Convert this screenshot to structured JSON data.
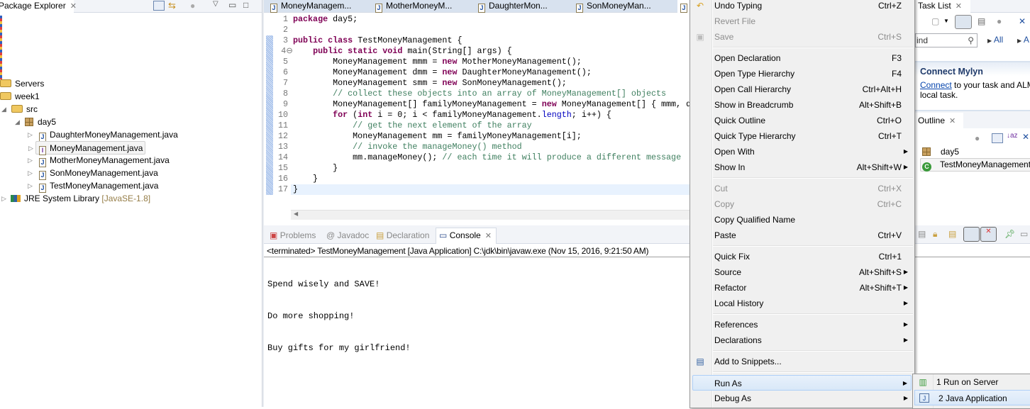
{
  "package_explorer": {
    "title": "Package Explorer",
    "items": [
      {
        "label": "Servers",
        "type": "project"
      },
      {
        "label": "week1",
        "type": "project",
        "expanded": true
      },
      {
        "label": "src",
        "type": "source-folder",
        "expanded": true
      },
      {
        "label": "day5",
        "type": "package",
        "expanded": true
      },
      {
        "label": "DaughterMoneyManagement.java",
        "type": "java-file"
      },
      {
        "label": "MoneyManagement.java",
        "type": "java-interface-file",
        "selected": true
      },
      {
        "label": "MotherMoneyManagement.java",
        "type": "java-file"
      },
      {
        "label": "SonMoneyManagement.java",
        "type": "java-file"
      },
      {
        "label": "TestMoneyManagement.java",
        "type": "java-file"
      },
      {
        "label": "JRE System Library",
        "type": "library",
        "decoration": "[JavaSE-1.8]"
      }
    ]
  },
  "editor": {
    "tabs": [
      "MoneyManagem...",
      "MotherMoneyM...",
      "DaughterMon...",
      "SonMoneyMan..."
    ],
    "current_line": 17,
    "lines": [
      "package day5;",
      "",
      "public class TestMoneyManagement {",
      "    public static void main(String[] args) {",
      "        MoneyManagement mmm = new MotherMoneyManagement();",
      "        MoneyManagement dmm = new DaughterMoneyManagement();",
      "        MoneyManagement smm = new SonMoneyManagement();",
      "        // collect these objects into an array of MoneyManagement[] objects",
      "        MoneyManagement[] familyMoneyManagement = new MoneyManagement[] { mmm, d",
      "        for (int i = 0; i < familyMoneyManagement.length; i++) {",
      "            // get the next element of the array",
      "            MoneyManagement mm = familyMoneyManagement[i];",
      "            // invoke the manageMoney() method",
      "            mm.manageMoney(); // each time it will produce a different message",
      "        }",
      "    }",
      "}"
    ]
  },
  "bottom_panel": {
    "tabs": [
      "Problems",
      "Javadoc",
      "Declaration",
      "Console"
    ],
    "active_tab": "Console",
    "console_header": "<terminated> TestMoneyManagement [Java Application] C:\\jdk\\bin\\javaw.exe (Nov 15, 2016, 9:21:50 AM)",
    "output": [
      "Spend wisely and SAVE!",
      "Do more shopping!",
      "Buy gifts for my girlfriend!"
    ]
  },
  "context_menu": {
    "groups": [
      [
        {
          "label": "Undo Typing",
          "shortcut": "Ctrl+Z",
          "icon": "undo-icon"
        },
        {
          "label": "Revert File",
          "disabled": true
        },
        {
          "label": "Save",
          "shortcut": "Ctrl+S",
          "disabled": true,
          "icon": "save-icon"
        }
      ],
      [
        {
          "label": "Open Declaration",
          "shortcut": "F3"
        },
        {
          "label": "Open Type Hierarchy",
          "shortcut": "F4"
        },
        {
          "label": "Open Call Hierarchy",
          "shortcut": "Ctrl+Alt+H"
        },
        {
          "label": "Show in Breadcrumb",
          "shortcut": "Alt+Shift+B"
        },
        {
          "label": "Quick Outline",
          "shortcut": "Ctrl+O"
        },
        {
          "label": "Quick Type Hierarchy",
          "shortcut": "Ctrl+T"
        },
        {
          "label": "Open With",
          "submenu": true
        },
        {
          "label": "Show In",
          "shortcut": "Alt+Shift+W",
          "submenu": true
        }
      ],
      [
        {
          "label": "Cut",
          "shortcut": "Ctrl+X",
          "disabled": true
        },
        {
          "label": "Copy",
          "shortcut": "Ctrl+C",
          "disabled": true
        },
        {
          "label": "Copy Qualified Name"
        },
        {
          "label": "Paste",
          "shortcut": "Ctrl+V"
        }
      ],
      [
        {
          "label": "Quick Fix",
          "shortcut": "Ctrl+1"
        },
        {
          "label": "Source",
          "shortcut": "Alt+Shift+S",
          "submenu": true
        },
        {
          "label": "Refactor",
          "shortcut": "Alt+Shift+T",
          "submenu": true
        },
        {
          "label": "Local History",
          "submenu": true
        }
      ],
      [
        {
          "label": "References",
          "submenu": true
        },
        {
          "label": "Declarations",
          "submenu": true
        }
      ],
      [
        {
          "label": "Add to Snippets...",
          "icon": "snippets-icon"
        }
      ],
      [
        {
          "label": "Run As",
          "submenu": true,
          "highlighted": true
        },
        {
          "label": "Debug As",
          "submenu": true
        }
      ]
    ]
  },
  "run_as_submenu": [
    {
      "label": "1 Run on Server",
      "icon": "run-on-server-icon"
    },
    {
      "label": "2 Java Application",
      "icon": "java-application-icon",
      "highlighted": true
    }
  ],
  "task_list": {
    "title": "Task List",
    "find_placeholder": "ind",
    "filter_all_1": "All",
    "filter_all_2": "A"
  },
  "mylyn": {
    "title": "Connect Mylyn",
    "link": "Connect",
    "text": " to your task and ALM",
    "text2": "local task."
  },
  "outline": {
    "title": "Outline",
    "items": [
      {
        "label": "day5",
        "type": "package"
      },
      {
        "label": "TestMoneyManagement",
        "type": "class",
        "selected": true
      }
    ]
  }
}
